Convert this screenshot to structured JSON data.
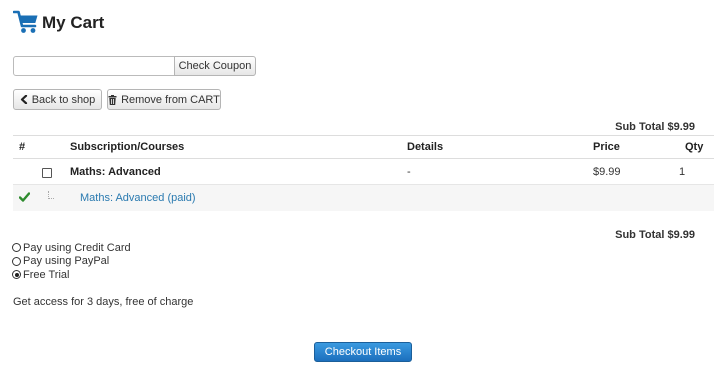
{
  "header": {
    "title": "My Cart",
    "icon": "shopping-cart-icon",
    "icon_color": "#1a6fb5"
  },
  "coupon": {
    "value": "",
    "placeholder": "",
    "button_label": "Check Coupon"
  },
  "actions": {
    "back_label": "Back to shop",
    "back_icon": "chevron-left-icon",
    "remove_label": "Remove from CART",
    "remove_icon": "trash-icon"
  },
  "summary": {
    "subtotal_top": "Sub Total $9.99",
    "subtotal_bottom": "Sub Total $9.99"
  },
  "table": {
    "columns": [
      "#",
      "Subscription/Courses",
      "Details",
      "Price",
      "Qty"
    ],
    "item": {
      "checked": false,
      "name": "Maths: Advanced",
      "details": "-",
      "price": "$9.99",
      "qty": "1"
    },
    "sub_item": {
      "status_icon": "checkmark-icon",
      "status_color": "#2e8b2e",
      "label": "Maths: Advanced (paid)"
    }
  },
  "payment": {
    "options": [
      {
        "label": "Pay using Credit Card",
        "selected": false
      },
      {
        "label": "Pay using PayPal",
        "selected": false
      },
      {
        "label": "Free Trial",
        "selected": true
      }
    ],
    "note": "Get access for 3 days, free of charge"
  },
  "checkout": {
    "label": "Checkout Items",
    "color": "#1c6fbd"
  }
}
